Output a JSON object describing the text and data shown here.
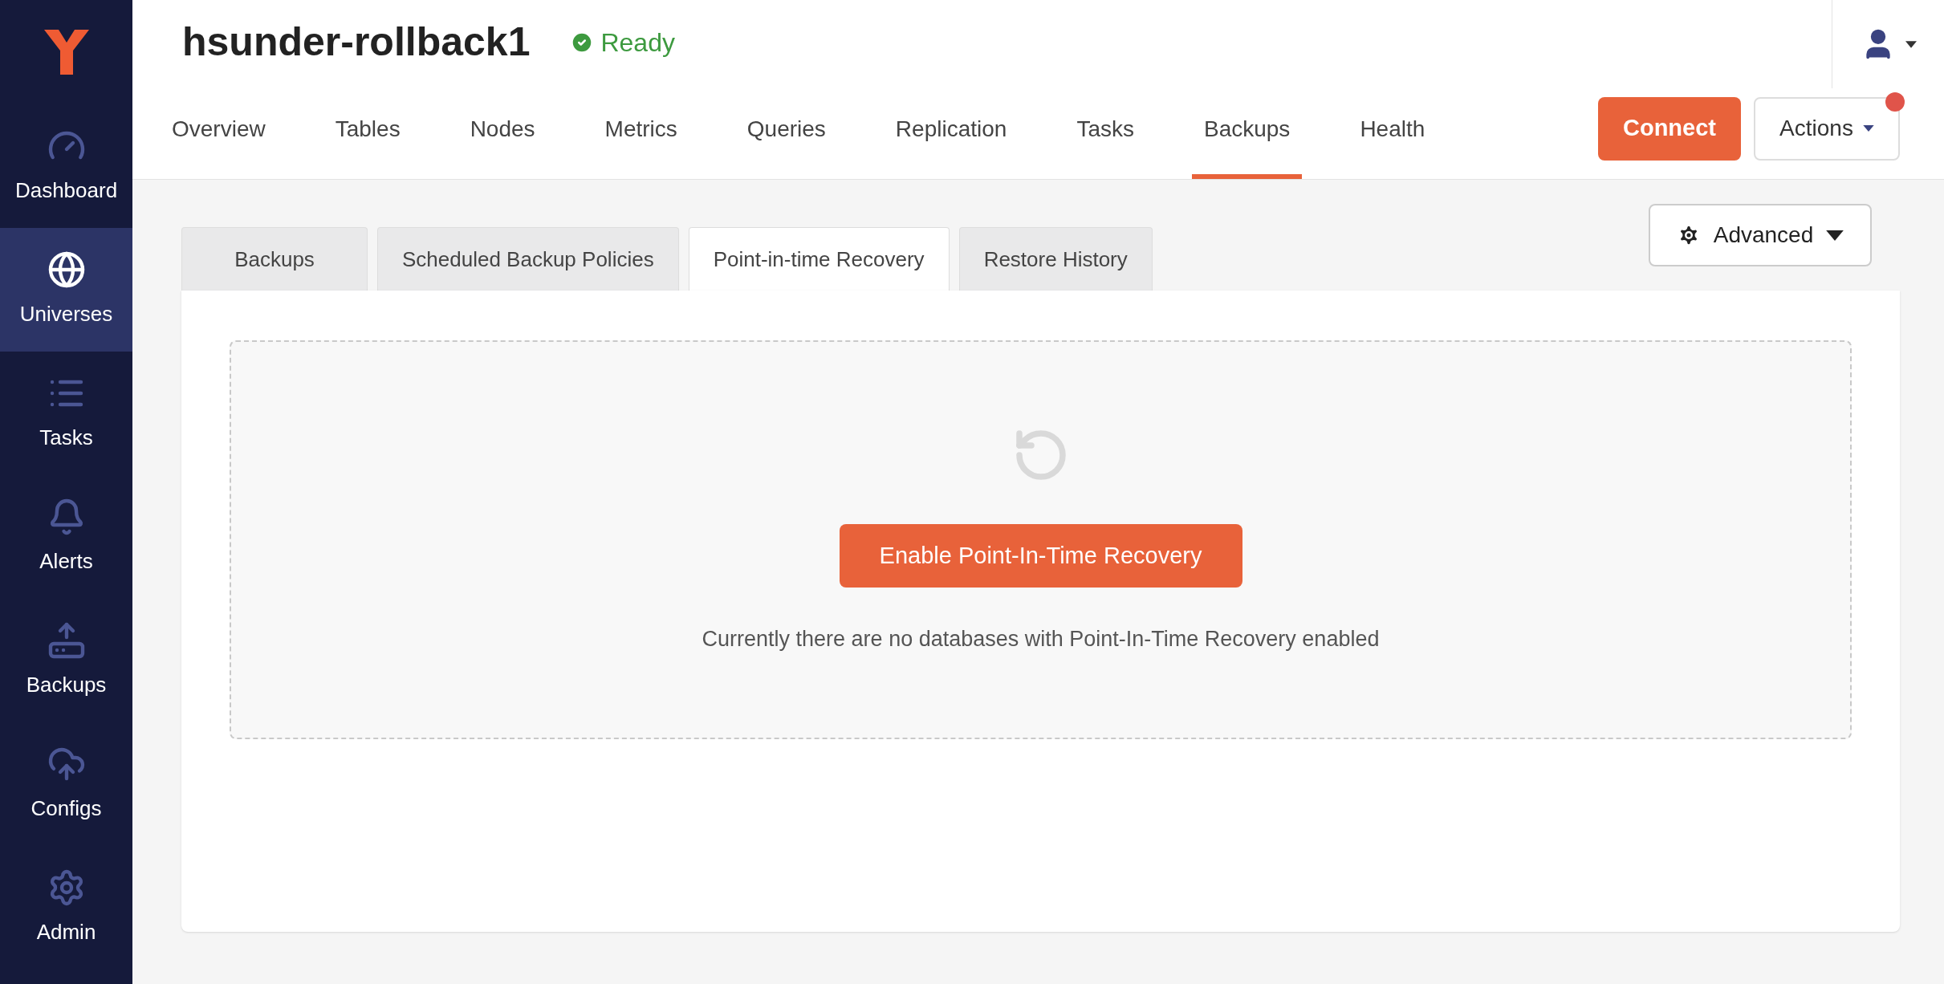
{
  "sidebar": {
    "items": [
      {
        "label": "Dashboard",
        "selected": false
      },
      {
        "label": "Universes",
        "selected": true
      },
      {
        "label": "Tasks",
        "selected": false
      },
      {
        "label": "Alerts",
        "selected": false
      },
      {
        "label": "Backups",
        "selected": false
      },
      {
        "label": "Configs",
        "selected": false
      },
      {
        "label": "Admin",
        "selected": false
      }
    ]
  },
  "header": {
    "title": "hsunder-rollback1",
    "status": "Ready",
    "notification": true
  },
  "tabs": [
    {
      "label": "Overview",
      "selected": false
    },
    {
      "label": "Tables",
      "selected": false
    },
    {
      "label": "Nodes",
      "selected": false
    },
    {
      "label": "Metrics",
      "selected": false
    },
    {
      "label": "Queries",
      "selected": false
    },
    {
      "label": "Replication",
      "selected": false
    },
    {
      "label": "Tasks",
      "selected": false
    },
    {
      "label": "Backups",
      "selected": true
    },
    {
      "label": "Health",
      "selected": false
    }
  ],
  "buttons": {
    "connect": "Connect",
    "actions": "Actions",
    "advanced": "Advanced"
  },
  "subtabs": [
    {
      "label": "Backups",
      "selected": false
    },
    {
      "label": "Scheduled Backup Policies",
      "selected": false
    },
    {
      "label": "Point-in-time Recovery",
      "selected": true
    },
    {
      "label": "Restore History",
      "selected": false
    }
  ],
  "empty_state": {
    "button": "Enable Point-In-Time Recovery",
    "message": "Currently there are no databases with Point-In-Time Recovery enabled"
  }
}
